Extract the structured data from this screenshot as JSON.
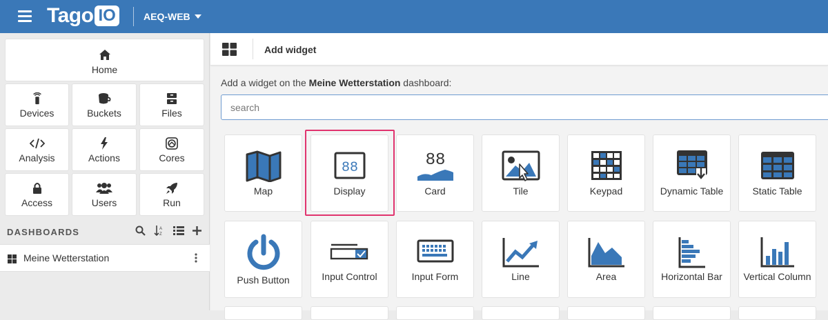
{
  "header": {
    "logo_text": "Tago",
    "logo_badge": "IO",
    "account_name": "AEQ-WEB",
    "bar_color": "#3a78b8"
  },
  "sidebar": {
    "home": {
      "label": "Home",
      "icon": "home-icon"
    },
    "items": [
      {
        "label": "Devices",
        "icon": "device-icon"
      },
      {
        "label": "Buckets",
        "icon": "bucket-icon"
      },
      {
        "label": "Files",
        "icon": "files-icon"
      },
      {
        "label": "Analysis",
        "icon": "code-icon"
      },
      {
        "label": "Actions",
        "icon": "bolt-icon"
      },
      {
        "label": "Cores",
        "icon": "cores-icon"
      },
      {
        "label": "Access",
        "icon": "lock-icon"
      },
      {
        "label": "Users",
        "icon": "users-icon"
      },
      {
        "label": "Run",
        "icon": "rocket-icon"
      }
    ],
    "dashboards_title": "DASHBOARDS",
    "dashboards": [
      {
        "label": "Meine Wetterstation"
      }
    ]
  },
  "main": {
    "title": "Add widget",
    "prompt_prefix": "Add a widget on the ",
    "dashboard_name": "Meine Wetterstation",
    "prompt_suffix": " dashboard:",
    "search_placeholder": "search",
    "accent_color": "#3a78b8",
    "highlight_color": "#e0336e",
    "widgets_row1": [
      {
        "label": "Map",
        "icon": "map-icon"
      },
      {
        "label": "Display",
        "icon": "display-icon",
        "highlighted": true
      },
      {
        "label": "Card",
        "icon": "card-icon",
        "glyph": "88"
      },
      {
        "label": "Tile",
        "icon": "tile-icon"
      },
      {
        "label": "Keypad",
        "icon": "keypad-icon"
      },
      {
        "label": "Dynamic Table",
        "icon": "dynamic-table-icon"
      },
      {
        "label": "Static Table",
        "icon": "static-table-icon"
      }
    ],
    "widgets_row2": [
      {
        "label": "Push Button",
        "icon": "power-icon"
      },
      {
        "label": "Input Control",
        "icon": "input-control-icon"
      },
      {
        "label": "Input Form",
        "icon": "keyboard-icon"
      },
      {
        "label": "Line",
        "icon": "line-chart-icon"
      },
      {
        "label": "Area",
        "icon": "area-chart-icon"
      },
      {
        "label": "Horizontal Bar",
        "icon": "horizontal-bar-icon"
      },
      {
        "label": "Vertical Column",
        "icon": "vertical-column-icon"
      }
    ]
  }
}
